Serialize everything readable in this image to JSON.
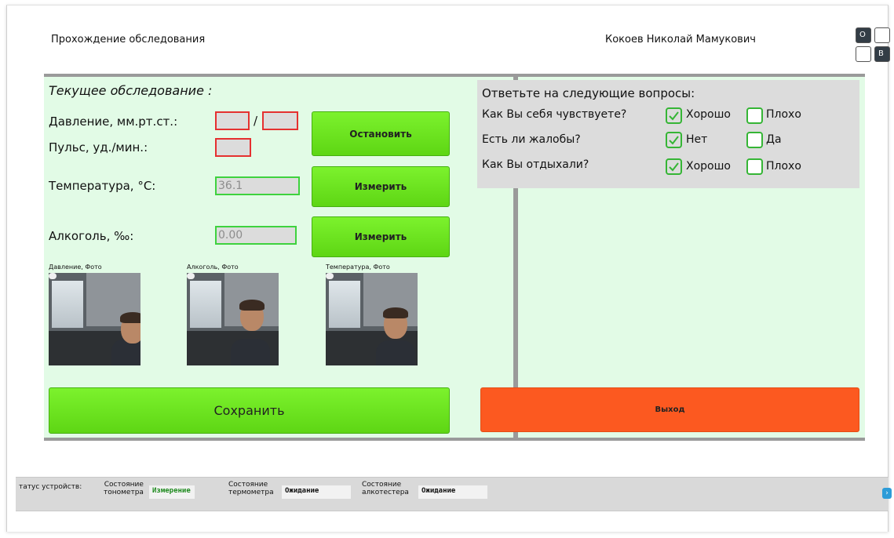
{
  "header": {
    "title": "Прохождение обследования",
    "user": "Кокоев Николай Мамукович",
    "lang_toggle": {
      "o_label": "О",
      "b_label": "В"
    }
  },
  "left": {
    "section_title": "Текущее обследование :",
    "pressure_label": "Давление, мм.рт.ст.:",
    "pressure_sys": "",
    "pressure_dia": "",
    "pressure_sep": "/",
    "pulse_label": "Пульс, уд./мин.:",
    "pulse_value": "",
    "temp_label": "Температура, °С:",
    "temp_value": "36.1",
    "alcohol_label": "Алкоголь, ‰:",
    "alcohol_value": "0.00",
    "stop_button": "Остановить",
    "measure_temp_button": "Измерить",
    "measure_alcohol_button": "Измерить",
    "photos": [
      {
        "label": "Давление, Фото"
      },
      {
        "label": "Алкоголь, Фото"
      },
      {
        "label": "Температура, Фото"
      }
    ],
    "save_button": "Сохранить"
  },
  "right": {
    "questions_title": "Ответьте на следующие вопросы:",
    "questions": [
      {
        "text": "Как Вы себя чувствуете?",
        "option_yes": "Хорошо",
        "option_no": "Плохо",
        "selected": "yes"
      },
      {
        "text": "Есть ли жалобы?",
        "option_yes": "Нет",
        "option_no": "Да",
        "selected": "yes"
      },
      {
        "text": "Как Вы отдыхали?",
        "option_yes": "Хорошо",
        "option_no": "Плохо",
        "selected": "yes"
      }
    ],
    "exit_button": "Выход"
  },
  "statusbar": {
    "caption": "татус устройств:",
    "devices": [
      {
        "label_line1": "Состояние",
        "label_line2": "тонометра",
        "value": "Измерение"
      },
      {
        "label_line1": "Состояние",
        "label_line2": "термометра",
        "value": "Ожидание"
      },
      {
        "label_line1": "Состояние",
        "label_line2": "алкотестера",
        "value": "Ожидание"
      }
    ]
  },
  "colors": {
    "panel_bg": "#e2fbe6",
    "button_green": "#6ae61f",
    "button_exit": "#fc5920",
    "invalid_border": "#e53030",
    "valid_border": "#3ed23e"
  }
}
